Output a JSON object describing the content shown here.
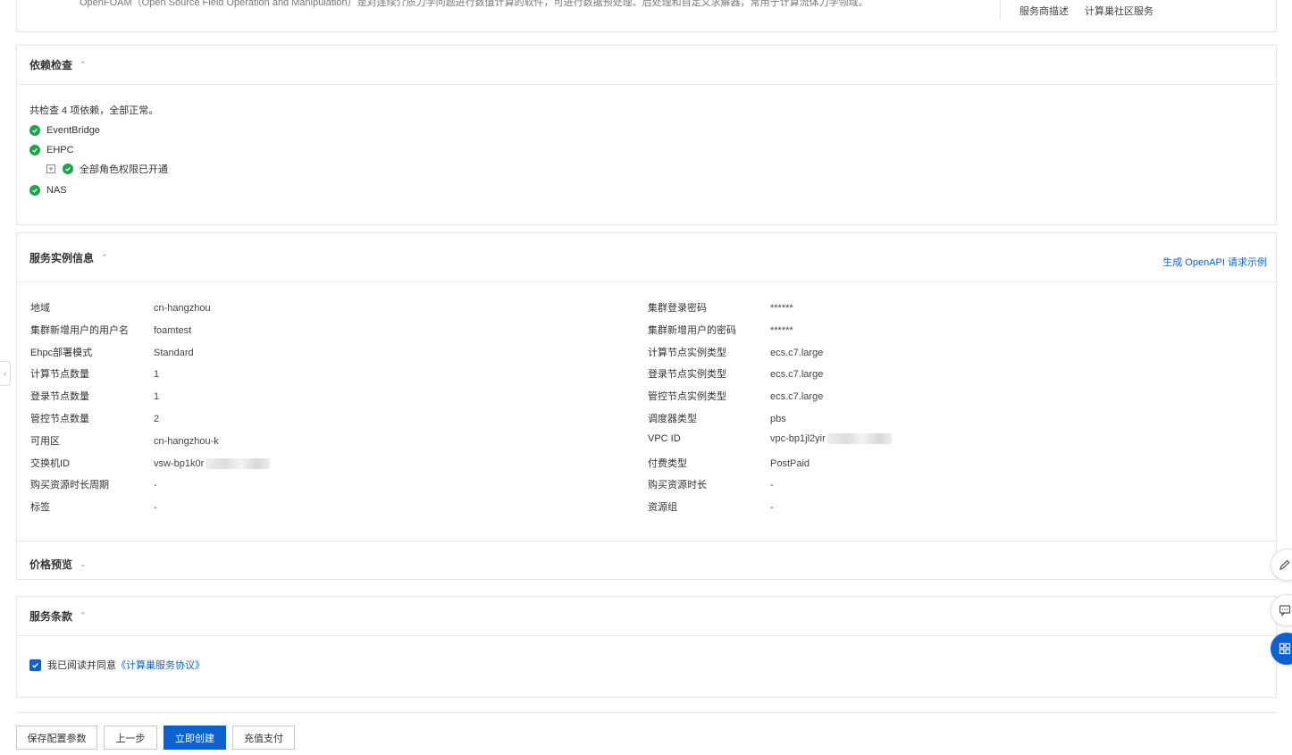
{
  "top_strip": {
    "description": "OpenFOAM（Open Source Field Operation and Manipulation）是对连续介质力学问题进行数值计算的软件，可进行数据预处理、后处理和自定义求解器，常用于计算流体力学领域。",
    "links": [
      "服务商描述",
      "计算巢社区服务"
    ]
  },
  "dependency": {
    "title": "依赖检查",
    "summary": "共检查 4 项依赖，全部正常。",
    "items": [
      {
        "name": "EventBridge"
      },
      {
        "name": "EHPC"
      },
      {
        "name": "全部角色权限已开通"
      },
      {
        "name": "NAS"
      }
    ]
  },
  "instance": {
    "title": "服务实例信息",
    "openapi_link": "生成 OpenAPI 请求示例",
    "left": [
      {
        "k": "地域",
        "v": "cn-hangzhou"
      },
      {
        "k": "集群新增用户的用户名",
        "v": "foamtest"
      },
      {
        "k": "Ehpc部署模式",
        "v": "Standard"
      },
      {
        "k": "计算节点数量",
        "v": "1"
      },
      {
        "k": "登录节点数量",
        "v": "1"
      },
      {
        "k": "管控节点数量",
        "v": "2"
      },
      {
        "k": "可用区",
        "v": "cn-hangzhou-k"
      },
      {
        "k": "交换机ID",
        "v": "vsw-bp1k0r"
      },
      {
        "k": "购买资源时长周期",
        "v": "-"
      },
      {
        "k": "标签",
        "v": "-"
      }
    ],
    "right": [
      {
        "k": "集群登录密码",
        "v": "******"
      },
      {
        "k": "集群新增用户的密码",
        "v": "******"
      },
      {
        "k": "计算节点实例类型",
        "v": "ecs.c7.large"
      },
      {
        "k": "登录节点实例类型",
        "v": "ecs.c7.large"
      },
      {
        "k": "管控节点实例类型",
        "v": "ecs.c7.large"
      },
      {
        "k": "调度器类型",
        "v": "pbs"
      },
      {
        "k": "VPC ID",
        "v": "vpc-bp1jl2yir"
      },
      {
        "k": "付费类型",
        "v": "PostPaid"
      },
      {
        "k": "购买资源时长",
        "v": "-"
      },
      {
        "k": "资源组",
        "v": "-"
      }
    ]
  },
  "price": {
    "title": "价格预览"
  },
  "terms": {
    "title": "服务条款",
    "agree_text": "我已阅读并同意",
    "agreement_link": "《计算巢服务协议》"
  },
  "footer": {
    "save_params": "保存配置参数",
    "prev_step": "上一步",
    "create_now": "立即创建",
    "recharge": "充值支付"
  },
  "colors": {
    "primary": "#0a62d1",
    "success": "#1aa548"
  }
}
